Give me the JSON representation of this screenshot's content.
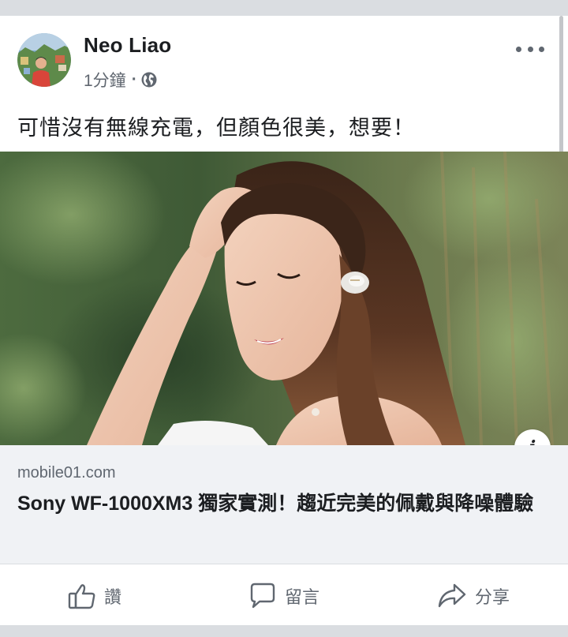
{
  "post": {
    "author": "Neo Liao",
    "time": "1分鐘",
    "separator": "·",
    "privacy_icon": "globe-icon",
    "text": "可惜沒有無線充電，但顏色很美，想要！"
  },
  "link_preview": {
    "domain": "mobile01.com",
    "title": "Sony WF-1000XM3 獨家實測！趨近完美的佩戴與降噪體驗",
    "info_icon": "i"
  },
  "actions": {
    "like": "讚",
    "comment": "留言",
    "share": "分享"
  },
  "colors": {
    "text_primary": "#1c1e21",
    "text_secondary": "#606770",
    "link_bg": "#f0f2f5",
    "page_bg": "#dadde1"
  }
}
